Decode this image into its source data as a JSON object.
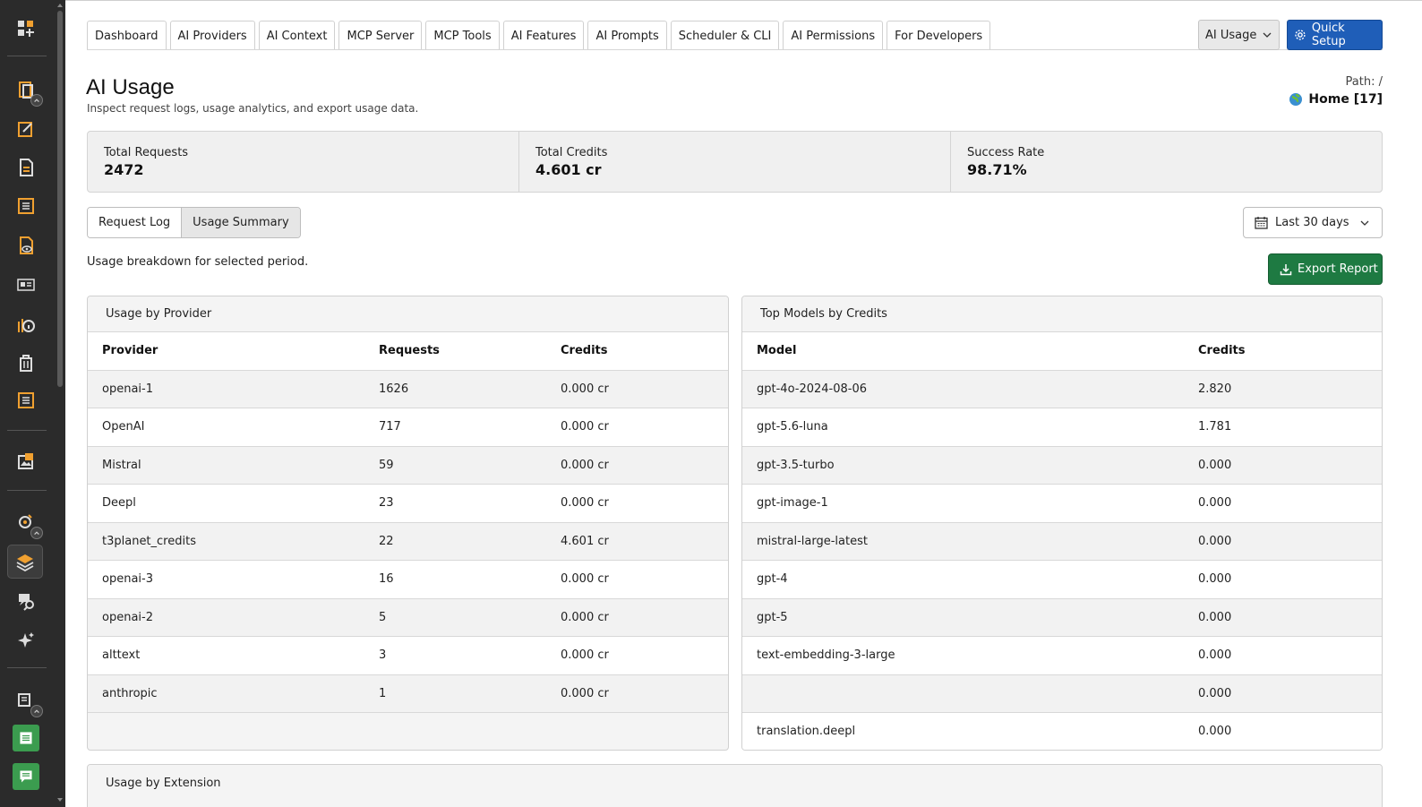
{
  "sidebar": {
    "icons": [
      "module-icon",
      "page-icon",
      "edit-icon",
      "document-icon",
      "list-icon",
      "view-icon",
      "news-icon",
      "info-icon",
      "trash-icon",
      "form-icon",
      "image-icon",
      "workspace-icon",
      "layers-icon",
      "translate-icon",
      "sparkle-icon",
      "records-icon",
      "notepad-icon",
      "chat-icon"
    ]
  },
  "tabs": [
    "Dashboard",
    "AI Providers",
    "AI Context",
    "MCP Server",
    "MCP Tools",
    "AI Features",
    "AI Prompts",
    "Scheduler & CLI",
    "AI Permissions",
    "For Developers"
  ],
  "header": {
    "usage_dropdown": "AI Usage",
    "quick_setup": "Quick Setup",
    "title": "AI Usage",
    "subtitle": "Inspect request logs, usage analytics, and export usage data.",
    "path_label": "Path: /",
    "path_home": "Home [17]"
  },
  "stats": [
    {
      "label": "Total Requests",
      "value": "2472"
    },
    {
      "label": "Total Credits",
      "value": "4.601 cr"
    },
    {
      "label": "Success Rate",
      "value": "98.71%"
    }
  ],
  "view_tabs": {
    "request_log": "Request Log",
    "usage_summary": "Usage Summary"
  },
  "period": "Last 30 days",
  "breakdown_text": "Usage breakdown for selected period.",
  "export_label": "Export Report",
  "provider_panel": {
    "title": "Usage by Provider",
    "headers": [
      "Provider",
      "Requests",
      "Credits"
    ],
    "rows": [
      [
        "openai-1",
        "1626",
        "0.000 cr"
      ],
      [
        "OpenAI",
        "717",
        "0.000 cr"
      ],
      [
        "Mistral",
        "59",
        "0.000 cr"
      ],
      [
        "Deepl",
        "23",
        "0.000 cr"
      ],
      [
        "t3planet_credits",
        "22",
        "4.601 cr"
      ],
      [
        "openai-3",
        "16",
        "0.000 cr"
      ],
      [
        "openai-2",
        "5",
        "0.000 cr"
      ],
      [
        "alttext",
        "3",
        "0.000 cr"
      ],
      [
        "anthropic",
        "1",
        "0.000 cr"
      ]
    ]
  },
  "models_panel": {
    "title": "Top Models by Credits",
    "headers": [
      "Model",
      "Credits"
    ],
    "rows": [
      [
        "gpt-4o-2024-08-06",
        "2.820"
      ],
      [
        "gpt-5.6-luna",
        "1.781"
      ],
      [
        "gpt-3.5-turbo",
        "0.000"
      ],
      [
        "gpt-image-1",
        "0.000"
      ],
      [
        "mistral-large-latest",
        "0.000"
      ],
      [
        "gpt-4",
        "0.000"
      ],
      [
        "gpt-5",
        "0.000"
      ],
      [
        "text-embedding-3-large",
        "0.000"
      ],
      [
        "",
        "0.000"
      ],
      [
        "translation.deepl",
        "0.000"
      ]
    ]
  },
  "extension_panel": {
    "title": "Usage by Extension"
  },
  "colors": {
    "quick_setup": "#1f5eb8",
    "export": "#1e7a42",
    "sidebar": "#2b2b2b",
    "accent_orange": "#f0a030"
  }
}
